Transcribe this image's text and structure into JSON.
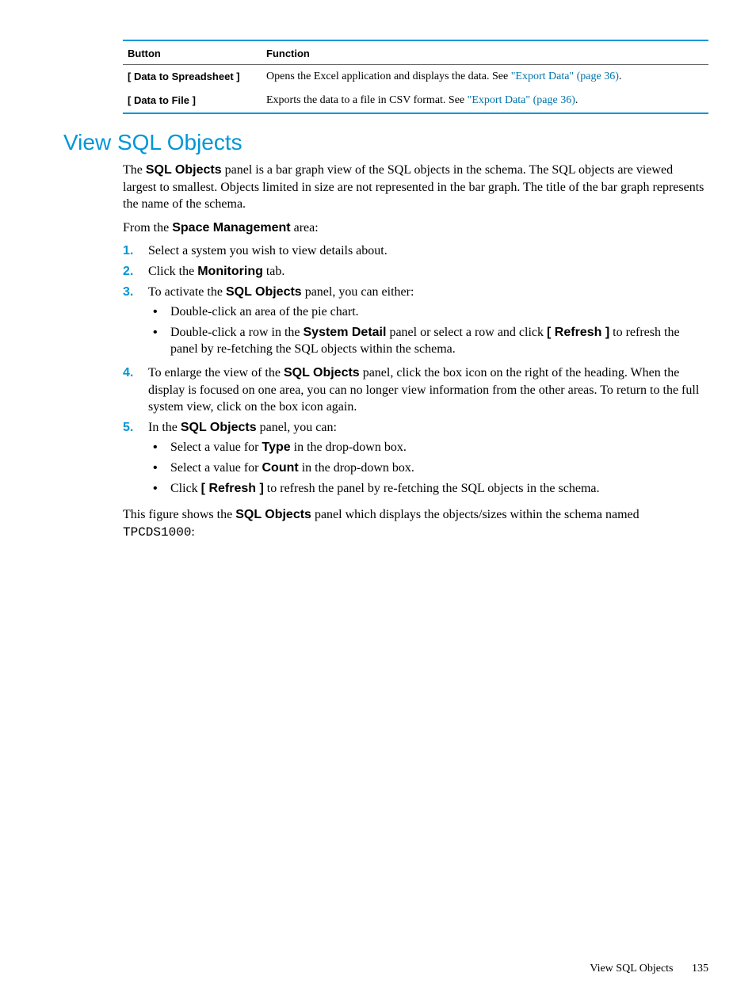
{
  "table": {
    "headers": {
      "button": "Button",
      "function": "Function"
    },
    "rows": [
      {
        "button": "[ Data to Spreadsheet ]",
        "func_pre": "Opens the Excel application and displays the data. See ",
        "link": "\"Export Data\" (page 36)",
        "func_post": "."
      },
      {
        "button": "[ Data to File ]",
        "func_pre": "Exports the data to a file in CSV format. See ",
        "link": "\"Export Data\" (page 36)",
        "func_post": "."
      }
    ]
  },
  "heading": "View SQL Objects",
  "intro": {
    "p1_a": "The ",
    "p1_b": "SQL Objects",
    "p1_c": " panel is a bar graph view of the SQL objects in the schema. The SQL objects are viewed largest to smallest. Objects limited in size are not represented in the bar graph. The title of the bar graph represents the name of the schema.",
    "p2_a": "From the ",
    "p2_b": "Space Management",
    "p2_c": " area:"
  },
  "steps": [
    {
      "num": "1.",
      "text": "Select a system you wish to view details about."
    },
    {
      "num": "2.",
      "pre": "Click the ",
      "bold": "Monitoring",
      "post": " tab."
    },
    {
      "num": "3.",
      "pre": "To activate the ",
      "bold": "SQL Objects",
      "post": " panel, you can either:",
      "bullets": [
        {
          "text": "Double-click an area of the pie chart."
        },
        {
          "segments": [
            {
              "t": "Double-click a row in the "
            },
            {
              "b": "System Detail"
            },
            {
              "t": " panel or select a row and click "
            },
            {
              "b": "[ Refresh ]"
            },
            {
              "t": " to refresh the panel by re-fetching the SQL objects within the schema."
            }
          ]
        }
      ]
    },
    {
      "num": "4.",
      "pre": "To enlarge the view of the ",
      "bold": "SQL Objects",
      "post": " panel, click the box icon on the right of the heading. When the display is focused on one area, you can no longer view information from the other areas. To return to the full system view, click on the box icon again."
    },
    {
      "num": "5.",
      "pre": "In the ",
      "bold": "SQL Objects",
      "post": " panel, you can:",
      "bullets": [
        {
          "segments": [
            {
              "t": "Select a value for "
            },
            {
              "b": "Type"
            },
            {
              "t": " in the drop-down box."
            }
          ]
        },
        {
          "segments": [
            {
              "t": "Select a value for "
            },
            {
              "b": "Count"
            },
            {
              "t": " in the drop-down box."
            }
          ]
        },
        {
          "segments": [
            {
              "t": "Click "
            },
            {
              "b": "[ Refresh ]"
            },
            {
              "t": " to refresh the panel by re-fetching the SQL objects in the schema."
            }
          ]
        }
      ]
    }
  ],
  "closing": {
    "pre": "This figure shows the ",
    "bold": "SQL Objects",
    "mid": " panel which displays the objects/sizes within the schema named ",
    "mono": "TPCDS1000",
    "post": ":"
  },
  "footer": {
    "label": "View SQL Objects",
    "page": "135"
  }
}
